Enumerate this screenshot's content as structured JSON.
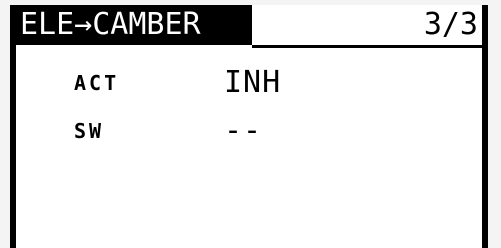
{
  "screen": {
    "title": "ELE→CAMBER",
    "page_indicator": "3/3"
  },
  "settings": [
    {
      "label": "ACT",
      "value": "INH"
    },
    {
      "label": "SW",
      "value": "--"
    }
  ],
  "colors": {
    "lcd_background": "#ffffff",
    "lcd_foreground": "#000000"
  }
}
